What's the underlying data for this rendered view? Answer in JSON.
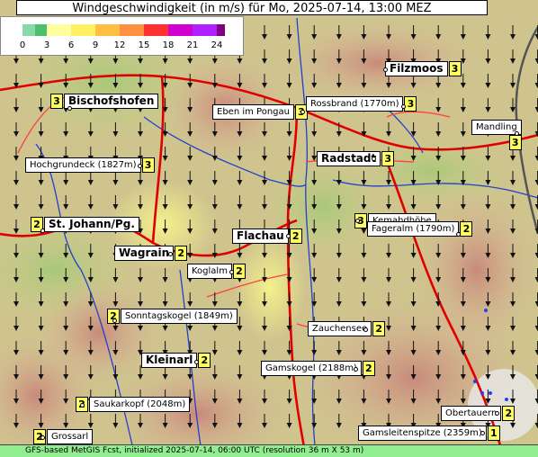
{
  "title": "Windgeschwindigkeit (in m/s) für Mo, 2025-07-14, 13:00 MEZ",
  "legend": {
    "ticks": [
      "0",
      "3",
      "6",
      "9",
      "12",
      "15",
      "18",
      "21",
      "24"
    ],
    "colors": [
      "#88d8a8",
      "#4cc070",
      "#ffffa0",
      "#fff060",
      "#ffc040",
      "#ff9040",
      "#ff3030",
      "#d000d0",
      "#b020ff",
      "#800080"
    ]
  },
  "wind_direction": "north",
  "places": [
    {
      "name": "Filzmoos",
      "value": "3",
      "big": true,
      "valuePos": "right"
    },
    {
      "name": "Bischofshofen",
      "value": "3",
      "big": true,
      "valuePos": "left"
    },
    {
      "name": "Eben im Pongau",
      "value": "3",
      "big": false,
      "valuePos": "right"
    },
    {
      "name": "Rossbrand (1770m)",
      "value": "3",
      "big": false,
      "valuePos": "right"
    },
    {
      "name": "Mandling",
      "value": "3",
      "big": false,
      "valuePos": "below"
    },
    {
      "name": "Hochgrundeck (1827m)",
      "value": "3",
      "big": false,
      "valuePos": "right"
    },
    {
      "name": "Radstadt",
      "value": "3",
      "big": true,
      "valuePos": "right"
    },
    {
      "name": "Kemahdhöhe",
      "value": "3",
      "big": false,
      "valuePos": "left"
    },
    {
      "name": "St. Johann/Pg.",
      "value": "2",
      "big": true,
      "valuePos": "left"
    },
    {
      "name": "Flachau",
      "value": "2",
      "big": true,
      "valuePos": "right"
    },
    {
      "name": "Fageralm (1790m)",
      "value": "2",
      "big": false,
      "valuePos": "right"
    },
    {
      "name": "Wagrain",
      "value": "2",
      "big": true,
      "valuePos": "right"
    },
    {
      "name": "Koglalm",
      "value": "2",
      "big": false,
      "valuePos": "right"
    },
    {
      "name": "Sonntagskogel (1849m)",
      "value": "2",
      "big": false,
      "valuePos": "left"
    },
    {
      "name": "Zauchensee",
      "value": "2",
      "big": false,
      "valuePos": "right"
    },
    {
      "name": "Kleinarl",
      "value": "2",
      "big": true,
      "valuePos": "right"
    },
    {
      "name": "Gamskogel (2188m)",
      "value": "2",
      "big": false,
      "valuePos": "right"
    },
    {
      "name": "Saukarkopf (2048m)",
      "value": "2",
      "big": false,
      "valuePos": "left"
    },
    {
      "name": "Obertauern",
      "value": "2",
      "big": false,
      "valuePos": "right"
    },
    {
      "name": "Grossarl",
      "value": "2",
      "big": false,
      "valuePos": "left"
    },
    {
      "name": "Gamsleitenspitze (2359m)",
      "value": "1",
      "big": false,
      "valuePos": "right"
    }
  ],
  "footer": "GFS-based MetGIS Fcst, initialized 2025-07-14, 06:00 UTC  (resolution 36 m X 53 m)"
}
